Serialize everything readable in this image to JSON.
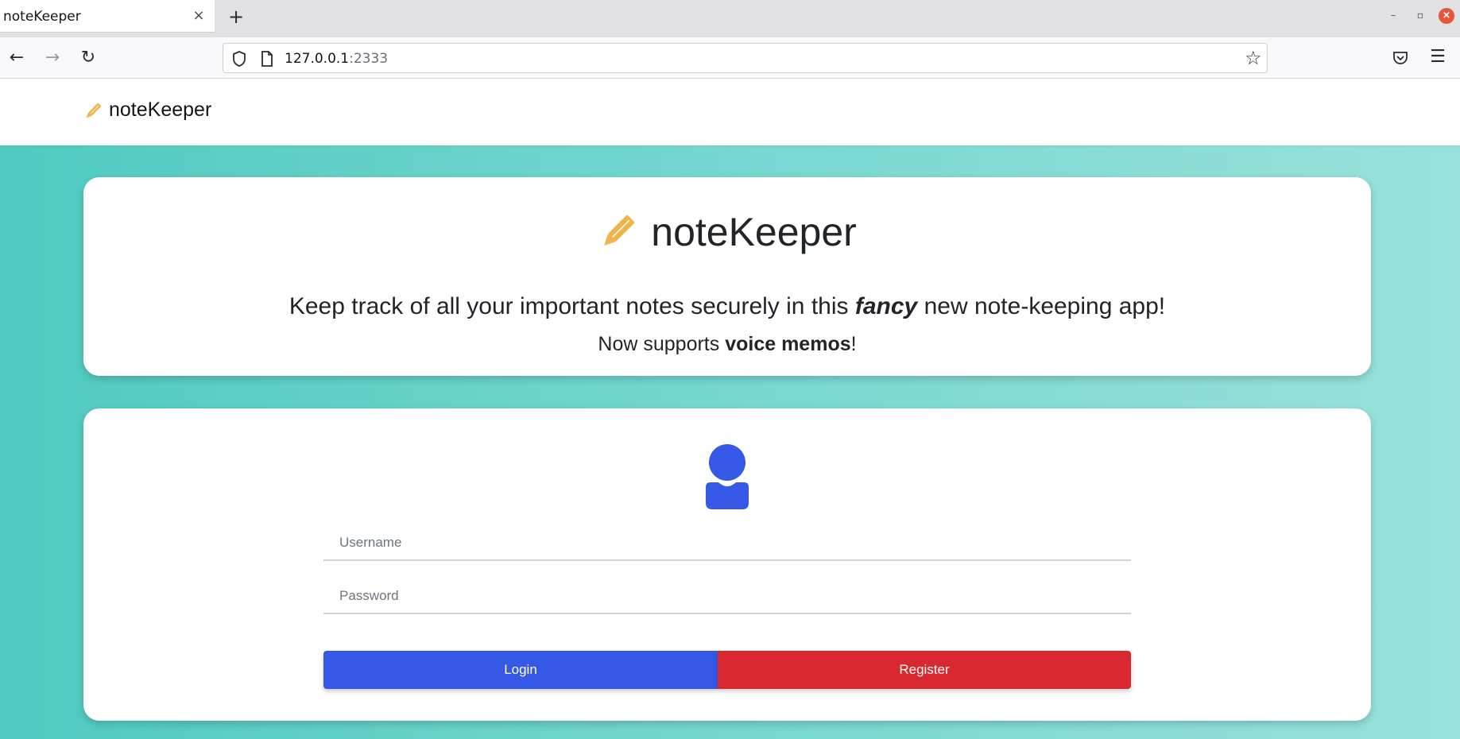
{
  "browser": {
    "tab_title": "noteKeeper",
    "tab_close": "×",
    "new_tab": "+",
    "url_host": "127.0.0.1",
    "url_port": ":2333",
    "back": "←",
    "forward": "→",
    "reload": "↻",
    "star": "☆",
    "menu": "☰",
    "win_minimize": "–",
    "win_maximize": "▫",
    "win_close": "×"
  },
  "header": {
    "brand": "noteKeeper",
    "brand_icon": "pencil-icon"
  },
  "hero": {
    "title": "noteKeeper",
    "tagline_before": "Keep track of all your important notes securely in this ",
    "tagline_emphasis": "fancy",
    "tagline_after": " new note-keeping app!",
    "sub_before": "Now supports ",
    "sub_bold": "voice memos",
    "sub_after": "!"
  },
  "login": {
    "icon": "user-icon",
    "username_placeholder": "Username",
    "password_placeholder": "Password",
    "login_label": "Login",
    "register_label": "Register"
  },
  "colors": {
    "accent_blue": "#3558e6",
    "danger_red": "#d9282f",
    "pencil_orange": "#f0b24a",
    "teal_background": "#4fcac0"
  }
}
